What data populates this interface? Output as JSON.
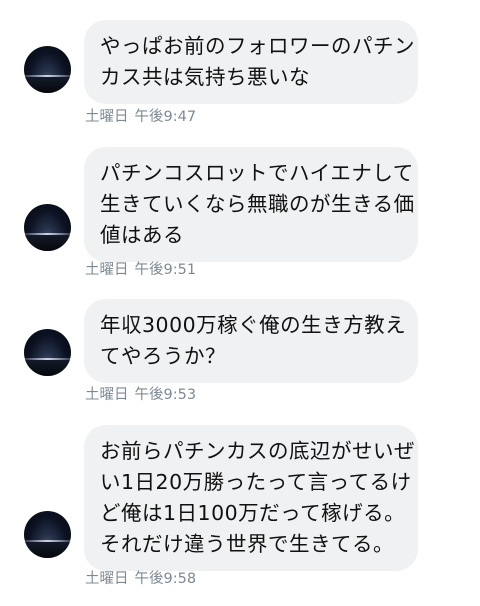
{
  "messages": [
    {
      "lines": [
        "やっぱお前のフォロワーのパチン",
        "カス共は気持ち悪いな"
      ],
      "day": "土曜日",
      "time": "午後9:47"
    },
    {
      "lines": [
        "パチンコスロットでハイエナして",
        "生きていくなら無職のが生きる価",
        "値はある"
      ],
      "day": "土曜日",
      "time": "午後9:51"
    },
    {
      "lines": [
        "年収3000万稼ぐ俺の生き方教え",
        "てやろうか？"
      ],
      "day": "土曜日",
      "time": "午後9:53"
    },
    {
      "lines": [
        "お前らパチンカスの底辺がせいぜ",
        "い1日20万勝ったって言ってるけ",
        "ど俺は1日100万だって稼げる。",
        "それだけ違う世界で生きてる。"
      ],
      "day": "土曜日",
      "time": "午後9:58"
    }
  ]
}
